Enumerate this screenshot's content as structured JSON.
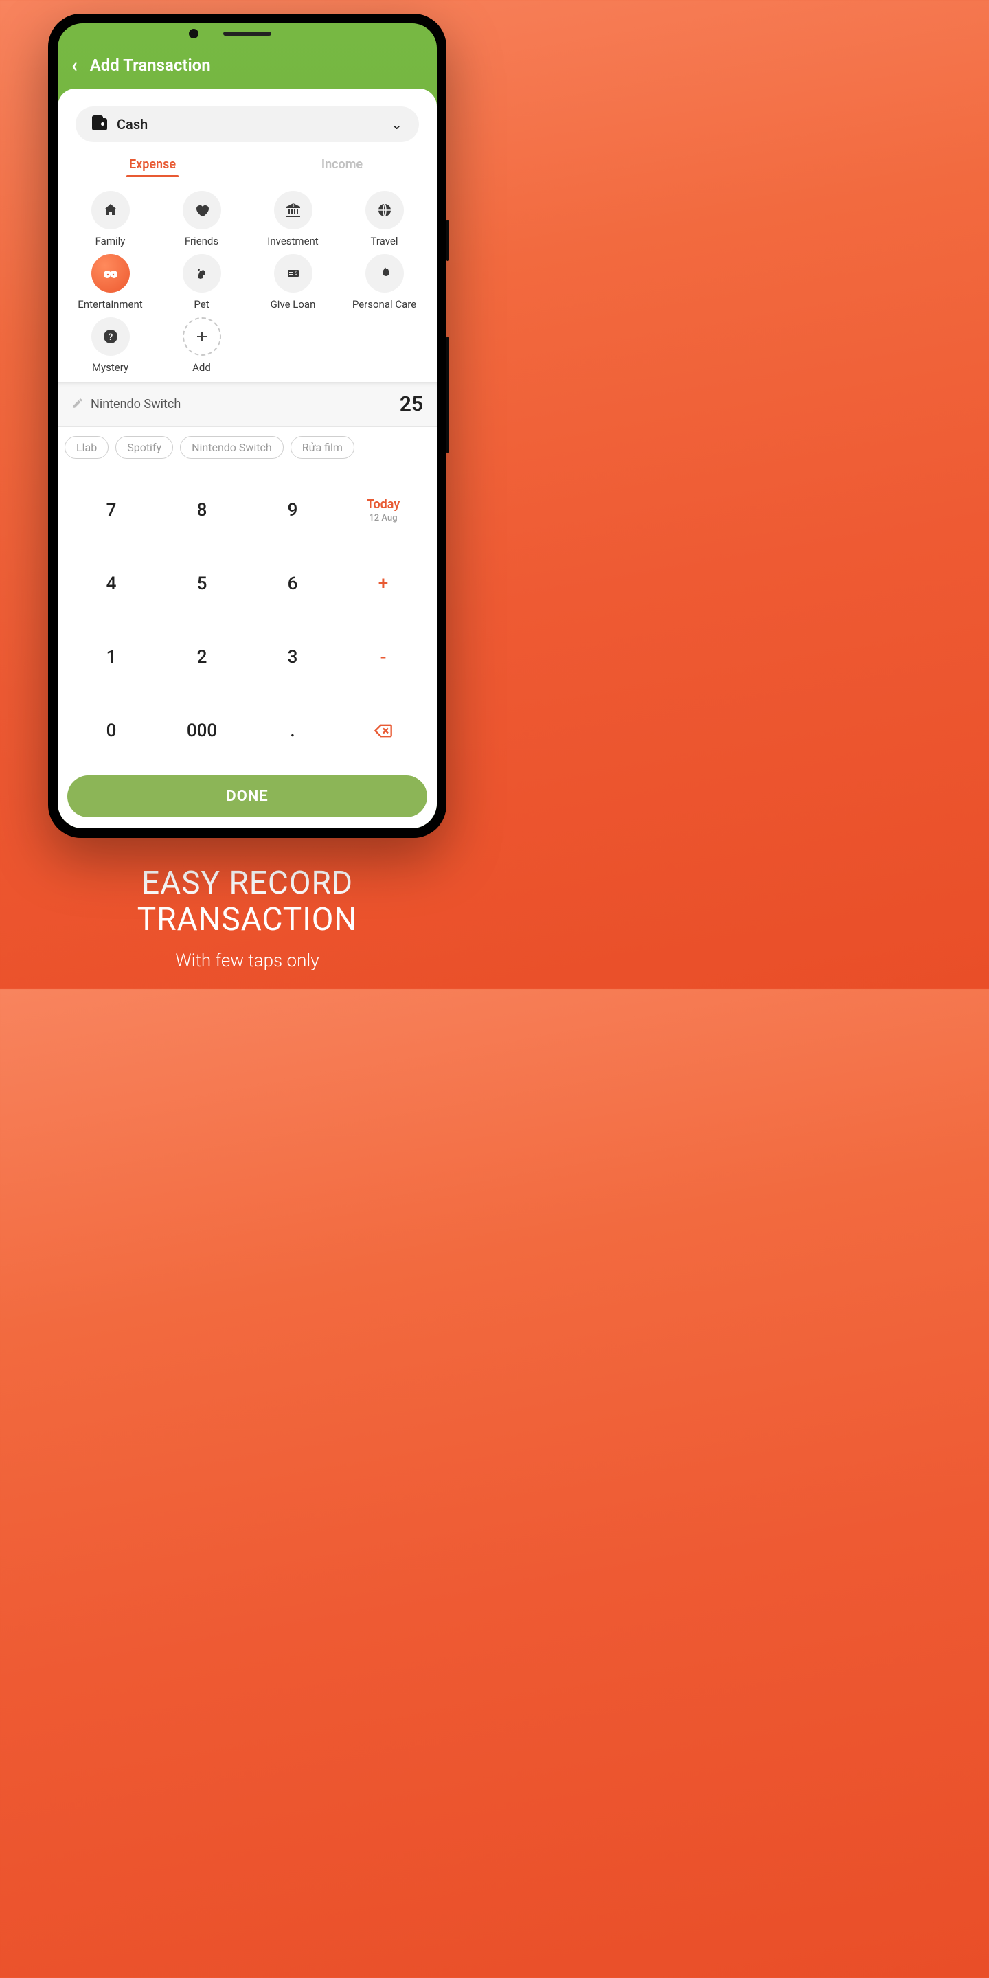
{
  "header": {
    "title": "Add Transaction"
  },
  "account": {
    "name": "Cash"
  },
  "tabs": {
    "expense": "Expense",
    "income": "Income"
  },
  "categories": [
    {
      "label": "Family",
      "icon": "house"
    },
    {
      "label": "Friends",
      "icon": "heart"
    },
    {
      "label": "Investment",
      "icon": "bank"
    },
    {
      "label": "Travel",
      "icon": "globe"
    },
    {
      "label": "Entertainment",
      "icon": "mask",
      "active": true
    },
    {
      "label": "Pet",
      "icon": "pet"
    },
    {
      "label": "Give Loan",
      "icon": "loan"
    },
    {
      "label": "Personal Care",
      "icon": "flame"
    },
    {
      "label": "Mystery",
      "icon": "question"
    },
    {
      "label": "Add",
      "icon": "plus",
      "dashed": true
    }
  ],
  "note": {
    "text": "Nintendo Switch"
  },
  "amount": "25",
  "chips": [
    "Llab",
    "Spotify",
    "Nintendo Switch",
    "Rửa film"
  ],
  "date": {
    "label": "Today",
    "sub": "12 Aug"
  },
  "keypad": {
    "r1": [
      "7",
      "8",
      "9"
    ],
    "r2": [
      "4",
      "5",
      "6",
      "+"
    ],
    "r3": [
      "1",
      "2",
      "3",
      "-"
    ],
    "r4": [
      "0",
      "000",
      "."
    ]
  },
  "done": "DONE",
  "promo": {
    "line1": "EASY RECORD",
    "line2": "TRANSACTION",
    "sub": "With few taps only"
  },
  "colors": {
    "accent": "#e85a33",
    "green": "#77b843",
    "done": "#8cb557"
  }
}
